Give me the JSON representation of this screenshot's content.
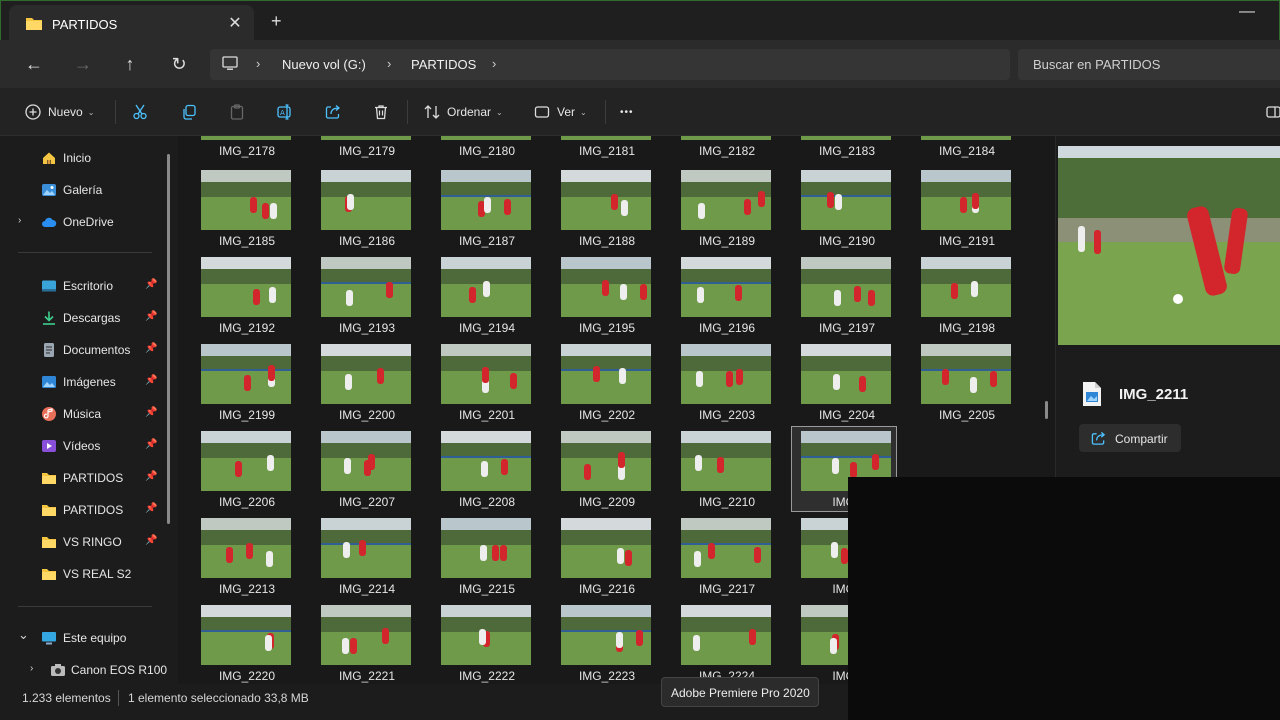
{
  "tab": {
    "title": "PARTIDOS",
    "close": "✕",
    "new_tab": "+"
  },
  "window": {
    "minimize": "—"
  },
  "addressbar": {
    "back": "←",
    "forward": "→",
    "up": "↑",
    "refresh": "↻",
    "separator": "›",
    "breadcrumbs": [
      "Nuevo vol (G:)",
      "PARTIDOS"
    ],
    "search_placeholder": "Buscar en PARTIDOS"
  },
  "toolbar": {
    "new_label": "Nuevo",
    "sort_label": "Ordenar",
    "view_label": "Ver",
    "more_label": "•••",
    "dropdown_glyph": "⌄"
  },
  "sidebar": {
    "pin_glyph": "📌",
    "expand_glyph": "›",
    "collapse_glyph": "⌄",
    "items": [
      {
        "label": "Inicio",
        "icon": "home-icon"
      },
      {
        "label": "Galería",
        "icon": "gallery-icon"
      },
      {
        "label": "OneDrive",
        "icon": "cloud-icon"
      },
      {
        "label": "Escritorio",
        "icon": "desktop-icon"
      },
      {
        "label": "Descargas",
        "icon": "download-icon"
      },
      {
        "label": "Documentos",
        "icon": "document-icon"
      },
      {
        "label": "Imágenes",
        "icon": "pictures-icon"
      },
      {
        "label": "Música",
        "icon": "music-icon"
      },
      {
        "label": "Vídeos",
        "icon": "video-icon"
      },
      {
        "label": "PARTIDOS",
        "icon": "folder-icon"
      },
      {
        "label": "PARTIDOS",
        "icon": "folder-icon"
      },
      {
        "label": "VS RINGO",
        "icon": "folder-icon"
      },
      {
        "label": "VS REAL S2",
        "icon": "folder-icon"
      },
      {
        "label": "Este equipo",
        "icon": "pc-icon"
      },
      {
        "label": "Canon EOS R100",
        "icon": "camera-icon"
      }
    ]
  },
  "files": {
    "row0": [
      "IMG_2178",
      "IMG_2179",
      "IMG_2180",
      "IMG_2181",
      "IMG_2182",
      "IMG_2183",
      "IMG_2184"
    ],
    "row1": [
      "IMG_2185",
      "IMG_2186",
      "IMG_2187",
      "IMG_2188",
      "IMG_2189",
      "IMG_2190",
      "IMG_2191"
    ],
    "row2": [
      "IMG_2192",
      "IMG_2193",
      "IMG_2194",
      "IMG_2195",
      "IMG_2196",
      "IMG_2197",
      "IMG_2198"
    ],
    "row3": [
      "IMG_2199",
      "IMG_2200",
      "IMG_2201",
      "IMG_2202",
      "IMG_2203",
      "IMG_2204",
      "IMG_2205"
    ],
    "row4": [
      "IMG_2206",
      "IMG_2207",
      "IMG_2208",
      "IMG_2209",
      "IMG_2210",
      "IMG_",
      ""
    ],
    "row5": [
      "IMG_2213",
      "IMG_2214",
      "IMG_2215",
      "IMG_2216",
      "IMG_2217",
      "IMG_",
      ""
    ],
    "row6": [
      "IMG_2220",
      "IMG_2221",
      "IMG_2222",
      "IMG_2223",
      "IMG_2224",
      "IMG_",
      ""
    ],
    "selected": "IMG_2211"
  },
  "preview": {
    "file_name": "IMG_2211",
    "share_label": "Compartir"
  },
  "status": {
    "count": "1.233 elementos",
    "selection": "1 elemento seleccionado  33,8 MB"
  },
  "tooltip": "Adobe Premiere Pro 2020",
  "colors": {
    "accent": "#4cc2ff",
    "folder": "#f4c542",
    "jersey_red": "#d3262c",
    "field": "#6f9a49"
  }
}
